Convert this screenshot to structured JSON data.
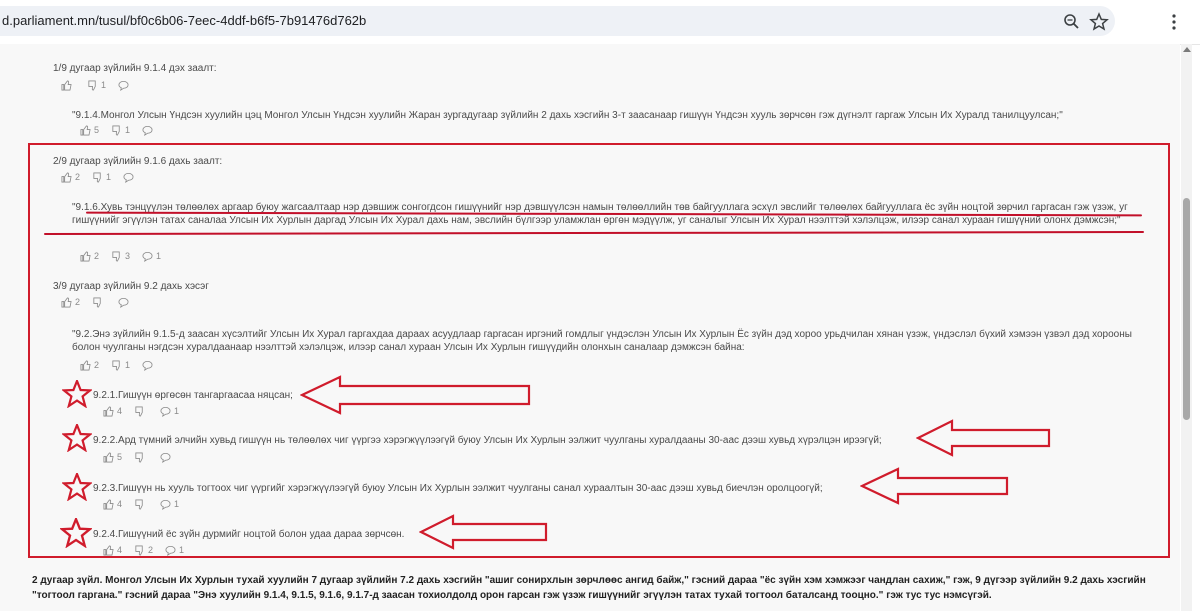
{
  "browser": {
    "url": "d.parliament.mn/tusul/bf0c6b06-7eec-4ddf-b6f5-7b91476d762b",
    "zoom_icon": "zoom-icon",
    "star_icon": "bookmark-star-icon",
    "menu_icon": "kebab-menu-icon"
  },
  "colors": {
    "accent": "#d01c2c",
    "text": "#4a4a4a"
  },
  "items": [
    {
      "title": "1/9 дугаар зүйлийн 9.1.4 дэх заалт:",
      "title_actions": {
        "likes": "",
        "dislikes": "1",
        "comments": ""
      },
      "quote": "\"9.1.4.Монгол Улсын Үндсэн хуулийн цэц Монгол Улсын Үндсэн хуулийн Жаран зургадугаар зүйлийн 2 дахь хэсгийн 3-т заасанаар гишүүн Үндсэн хууль зөрчсөн гэж дүгнэлт гаргаж Улсын Их Хуралд танилцуулсан;\"",
      "quote_actions": {
        "likes": "5",
        "dislikes": "1",
        "comments": ""
      }
    },
    {
      "title": "2/9 дугаар зүйлийн 9.1.6 дахь заалт:",
      "title_actions": {
        "likes": "2",
        "dislikes": "1",
        "comments": ""
      },
      "quote": "\"9.1.6.Хувь тэнцүүлэн төлөөлөх аргаар буюу жагсаалтаар нэр дэвшиж сонгогдсон гишүүнийг нэр дэвшүүлсэн намын төлөөллийн төв байгууллага эсхүл эвслийг төлөөлөх байгууллага ёс зүйн ноцтой зөрчил гаргасан гэж үзэж, уг гишүүнийг эгүүлэн татах саналаа Улсын Их Хурлын даргад Улсын Их Хурал дахь нам, эвслийн бүлгээр уламжлан өргөн мэдүүлж, уг саналыг Улсын Их Хурал нээлттэй хэлэлцэж, илээр санал хураан гишүүний олонх дэмжсэн;\"",
      "quote_actions": {
        "likes": "2",
        "dislikes": "3",
        "comments": "1"
      }
    },
    {
      "title": "3/9 дугаар зүйлийн 9.2 дахь хэсэг",
      "title_actions": {
        "likes": "2",
        "dislikes": "",
        "comments": ""
      },
      "quote": "\"9.2.Энэ зүйлийн 9.1.5-д заасан хүсэлтийг Улсын Их Хурал гаргахдаа дараах асуудлаар гаргасан иргэний гомдлыг үндэслэн Улсын Их Хурлын Ёс зүйн дэд хороо урьдчилан хянан үзэж, үндэслэл бүхий хэмээн үзвэл дэд хорооны болон чуулганы нэгдсэн хуралдаанаар нээлттэй хэлэлцэж, илээр санал хураан Улсын Их Хурлын гишүүдийн олонхын саналаар дэмжсэн байна:",
      "quote_actions": {
        "likes": "2",
        "dislikes": "1",
        "comments": ""
      }
    }
  ],
  "subitems": [
    {
      "text": "9.2.1.Гишүүн өргөсөн тангаргаасаа няцсан;",
      "likes": "4",
      "dislikes": "",
      "comments": "1"
    },
    {
      "text": "9.2.2.Ард түмний элчийн хувьд гишүүн нь төлөөлөх чиг үүргээ хэрэгжүүлээгүй буюу Улсын Их Хурлын ээлжит чуулганы хуралдааны 30-аас дээш хувьд хүрэлцэн ирээгүй;",
      "likes": "5",
      "dislikes": "",
      "comments": ""
    },
    {
      "text": "9.2.3.Гишүүн нь хууль тогтоох чиг үүргийг хэрэгжүүлээгүй буюу Улсын Их Хурлын ээлжит чуулганы санал хураалтын 30-аас дээш хувьд биечлэн оролцоогүй;",
      "likes": "4",
      "dislikes": "",
      "comments": "1"
    },
    {
      "text": "9.2.4.Гишүүний ёс зүйн дурмийг ноцтой болон удаа дараа зөрчсөн.",
      "likes": "4",
      "dislikes": "2",
      "comments": "1"
    }
  ],
  "bottom": {
    "text": "2 дугаар зүйл. Монгол Улсын Их Хурлын тухай хуулийн 7 дугаар зүйлийн 7.2 дахь хэсгийн \"ашиг сонирхлын зөрчлөөс ангид байж,\" гэсний дараа \"ёс зүйн хэм хэмжээг чандлан сахиж,\" гэж, 9 дүгээр зүйлийн 9.2 дахь хэсгийн \"тогтоол гаргана.\" гэсний дараа \"Энэ хуулийн 9.1.4, 9.1.5, 9.1.6, 9.1.7-д заасан тохиолдолд орон гарсан гэж үзэж гишүүнийг эгүүлэн татах тухай тогтоол баталсанд тооцно.\" гэж тус тус нэмсүгэй."
  }
}
